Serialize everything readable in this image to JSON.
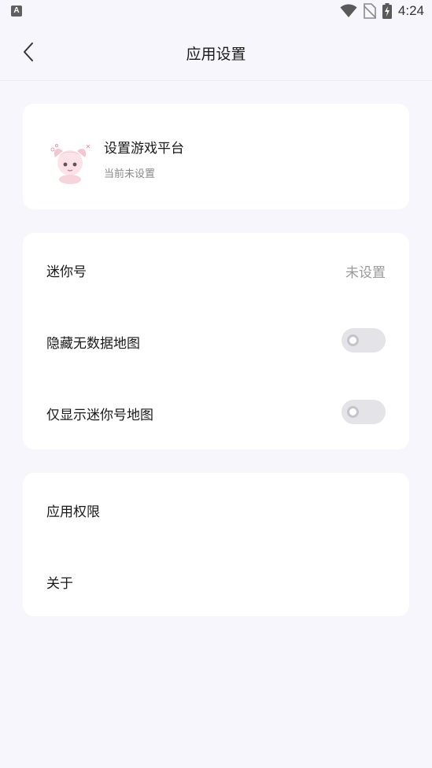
{
  "status_bar": {
    "time": "4:24",
    "a_badge": "A"
  },
  "header": {
    "title": "应用设置"
  },
  "platform": {
    "title": "设置游戏平台",
    "subtitle": "当前未设置"
  },
  "settings": {
    "mini_id_label": "迷你号",
    "mini_id_value": "未设置",
    "hide_nodata_label": "隐藏无数据地图",
    "hide_nodata_on": false,
    "only_mini_label": "仅显示迷你号地图",
    "only_mini_on": false
  },
  "about_section": {
    "permissions_label": "应用权限",
    "about_label": "关于"
  },
  "colors": {
    "background": "#f7f6fc",
    "card": "#ffffff",
    "toggle_off": "#e4e4e8"
  }
}
